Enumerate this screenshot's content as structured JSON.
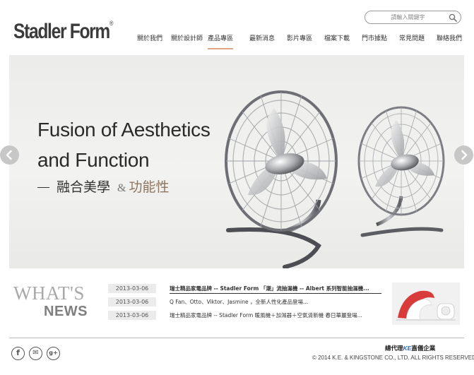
{
  "header": {
    "logo": "Stadler Form",
    "logo_mark": "®",
    "search_placeholder": "請輸入關鍵字",
    "nav": [
      {
        "label": "關於我們"
      },
      {
        "label": "關於設計師"
      },
      {
        "label": "產品專區",
        "active": true
      },
      {
        "label": "最新消息"
      },
      {
        "label": "影片專區"
      },
      {
        "label": "檔案下載"
      },
      {
        "label": "門市據點"
      },
      {
        "label": "常見問題"
      },
      {
        "label": "聯絡我們"
      }
    ]
  },
  "banner": {
    "headline_line1": "Fusion of Aesthetics",
    "headline_line2": "and Function",
    "zh_part1": "融合美學",
    "zh_amp": "&",
    "zh_part2": "功能性"
  },
  "news": {
    "heading_top": "WHAT'S",
    "heading_bottom": "NEWS",
    "items": [
      {
        "date": "2013-03-06",
        "text": "瑞士精品家電品牌 -- Stadler Form 「潮」流抽濕機 -- Albert 系列智能抽濕機..."
      },
      {
        "date": "2013-03-06",
        "text": "Q Fan、Otto、Viktor、Jasmine ，全新人性化產品登場..."
      },
      {
        "date": "2013-03-06",
        "text": "瑞士精品家電品牌 -- Stadler Form 暖風機＋加濕器＋空氣清新機 春日華麗登場..."
      }
    ]
  },
  "footer": {
    "social": [
      {
        "name": "facebook-icon",
        "glyph": "f"
      },
      {
        "name": "mail-icon",
        "glyph": "✉"
      },
      {
        "name": "google-plus-icon",
        "glyph": "g+"
      }
    ],
    "distributor_prefix": "總代理",
    "distributor_mark": "KE",
    "distributor_name": "嘉儀企業",
    "copyright": "© 2014  K.E. & KINGSTONE CO., LTD. ALL RIGHTS RESERVED."
  }
}
